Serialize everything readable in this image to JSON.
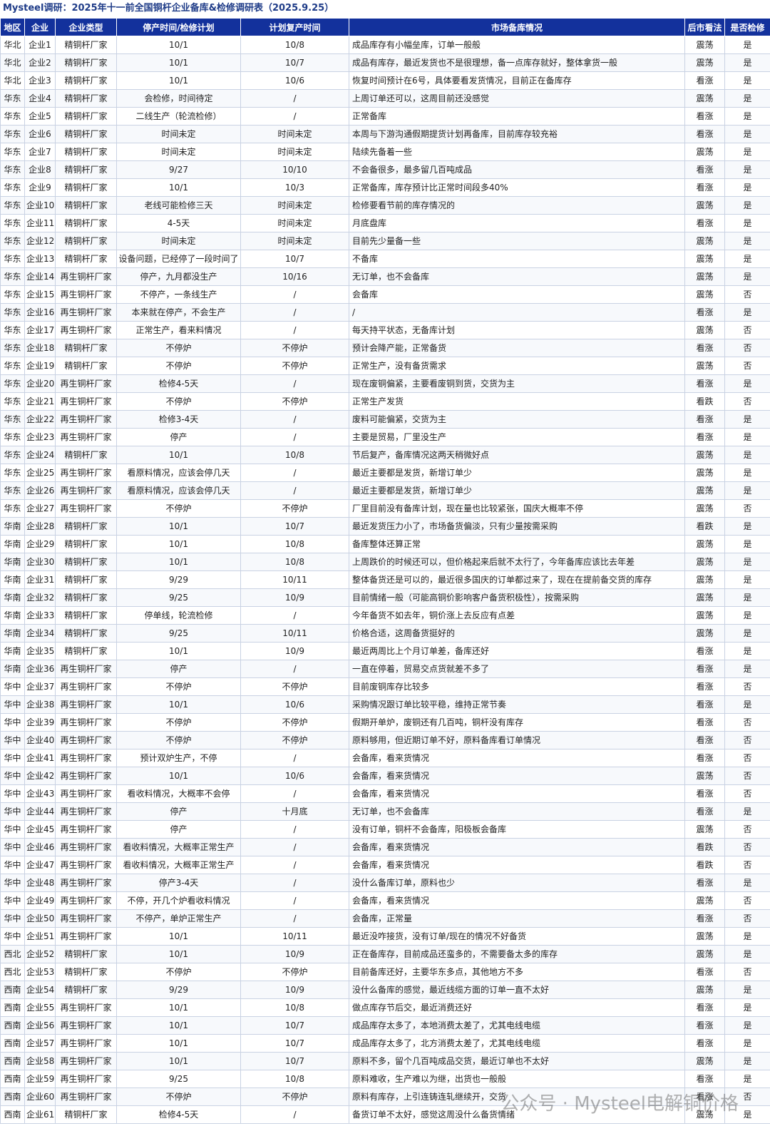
{
  "title": "Mysteel调研：2025年十一前全国铜杆企业备库&检修调研表（2025.9.25）",
  "headers": [
    "地区",
    "企业",
    "企业类型",
    "停产时间/检修计划",
    "计划复产时间",
    "市场备库情况",
    "后市看法",
    "是否检修"
  ],
  "rows": [
    [
      "华北",
      "企业1",
      "精铜杆厂家",
      "10/1",
      "10/8",
      "成品库存有小幅垒库，订单一般般",
      "震荡",
      "是"
    ],
    [
      "华北",
      "企业2",
      "精铜杆厂家",
      "10/1",
      "10/7",
      "成品有库存，最近发货也不是很理想，备一点库存就好，整体拿货一般",
      "震荡",
      "是"
    ],
    [
      "华北",
      "企业3",
      "精铜杆厂家",
      "10/1",
      "10/6",
      "恢复时间预计在6号，具体要看发货情况，目前正在备库存",
      "看涨",
      "是"
    ],
    [
      "华东",
      "企业4",
      "精铜杆厂家",
      "会检修，时间待定",
      "/",
      "上周订单还可以，这周目前还没感觉",
      "震荡",
      "是"
    ],
    [
      "华东",
      "企业5",
      "精铜杆厂家",
      "二线生产（轮流检修）",
      "/",
      "正常备库",
      "看涨",
      "是"
    ],
    [
      "华东",
      "企业6",
      "精铜杆厂家",
      "时间未定",
      "时间未定",
      "本周与下游沟通假期提货计划再备库，目前库存较充裕",
      "看涨",
      "是"
    ],
    [
      "华东",
      "企业7",
      "精铜杆厂家",
      "时间未定",
      "时间未定",
      "陆续先备着一些",
      "震荡",
      "是"
    ],
    [
      "华东",
      "企业8",
      "精铜杆厂家",
      "9/27",
      "10/10",
      "不会备很多，最多留几百吨成品",
      "看涨",
      "是"
    ],
    [
      "华东",
      "企业9",
      "精铜杆厂家",
      "10/1",
      "10/3",
      "正常备库，库存预计比正常时间段多40%",
      "看涨",
      "是"
    ],
    [
      "华东",
      "企业10",
      "精铜杆厂家",
      "老线可能检修三天",
      "时间未定",
      "检修要看节前的库存情况的",
      "震荡",
      "是"
    ],
    [
      "华东",
      "企业11",
      "精铜杆厂家",
      "4-5天",
      "时间未定",
      "月底盘库",
      "看涨",
      "是"
    ],
    [
      "华东",
      "企业12",
      "精铜杆厂家",
      "时间未定",
      "时间未定",
      "目前先少量备一些",
      "震荡",
      "是"
    ],
    [
      "华东",
      "企业13",
      "精铜杆厂家",
      "设备问题，已经停了一段时间了",
      "10/7",
      "不备库",
      "震荡",
      "是"
    ],
    [
      "华东",
      "企业14",
      "再生铜杆厂家",
      "停产，九月都没生产",
      "10/16",
      "无订单，也不会备库",
      "震荡",
      "是"
    ],
    [
      "华东",
      "企业15",
      "再生铜杆厂家",
      "不停产，一条线生产",
      "/",
      "会备库",
      "震荡",
      "否"
    ],
    [
      "华东",
      "企业16",
      "再生铜杆厂家",
      "本来就在停产，不会生产",
      "/",
      "/",
      "看涨",
      "是"
    ],
    [
      "华东",
      "企业17",
      "再生铜杆厂家",
      "正常生产，看来料情况",
      "/",
      "每天持平状态，无备库计划",
      "震荡",
      "否"
    ],
    [
      "华东",
      "企业18",
      "精铜杆厂家",
      "不停炉",
      "不停炉",
      "预计会降产能，正常备货",
      "看涨",
      "否"
    ],
    [
      "华东",
      "企业19",
      "精铜杆厂家",
      "不停炉",
      "不停炉",
      "正常生产，没有备货需求",
      "震荡",
      "否"
    ],
    [
      "华东",
      "企业20",
      "再生铜杆厂家",
      "检修4-5天",
      "/",
      "现在废铜偏紧，主要看废铜到货，交货为主",
      "看涨",
      "是"
    ],
    [
      "华东",
      "企业21",
      "再生铜杆厂家",
      "不停炉",
      "不停炉",
      "正常生产发货",
      "看跌",
      "否"
    ],
    [
      "华东",
      "企业22",
      "再生铜杆厂家",
      "检修3-4天",
      "/",
      "废料可能偏紧，交货为主",
      "看涨",
      "是"
    ],
    [
      "华东",
      "企业23",
      "再生铜杆厂家",
      "停产",
      "/",
      "主要是贸易，厂里没生产",
      "看涨",
      "是"
    ],
    [
      "华东",
      "企业24",
      "精铜杆厂家",
      "10/1",
      "10/8",
      "节后复产，备库情况这两天稍微好点",
      "震荡",
      "是"
    ],
    [
      "华东",
      "企业25",
      "再生铜杆厂家",
      "看原料情况，应该会停几天",
      "/",
      "最近主要都是发货，新增订单少",
      "震荡",
      "是"
    ],
    [
      "华东",
      "企业26",
      "再生铜杆厂家",
      "看原料情况，应该会停几天",
      "/",
      "最近主要都是发货，新增订单少",
      "震荡",
      "是"
    ],
    [
      "华东",
      "企业27",
      "再生铜杆厂家",
      "不停炉",
      "不停炉",
      "厂里目前没有备库计划，现在量也比较紧张，国庆大概率不停",
      "震荡",
      "否"
    ],
    [
      "华南",
      "企业28",
      "精铜杆厂家",
      "10/1",
      "10/7",
      "最近发货压力小了，市场备货偏淡，只有少量按需采购",
      "看跌",
      "是"
    ],
    [
      "华南",
      "企业29",
      "精铜杆厂家",
      "10/1",
      "10/8",
      "备库整体还算正常",
      "震荡",
      "是"
    ],
    [
      "华南",
      "企业30",
      "精铜杆厂家",
      "10/1",
      "10/8",
      "上周跌价的时候还可以，但价格起来后就不太行了，今年备库应该比去年差",
      "震荡",
      "是"
    ],
    [
      "华南",
      "企业31",
      "精铜杆厂家",
      "9/29",
      "10/11",
      "整体备货还是可以的，最近很多国庆的订单都过来了，现在在提前备交货的库存",
      "震荡",
      "是"
    ],
    [
      "华南",
      "企业32",
      "精铜杆厂家",
      "9/25",
      "10/9",
      "目前情绪一般（可能高铜价影响客户备货积极性），按需采购",
      "震荡",
      "是"
    ],
    [
      "华南",
      "企业33",
      "精铜杆厂家",
      "停单线，轮流检修",
      "/",
      "今年备货不如去年，铜价涨上去反应有点差",
      "震荡",
      "是"
    ],
    [
      "华南",
      "企业34",
      "精铜杆厂家",
      "9/25",
      "10/11",
      "价格合适，这周备货挺好的",
      "震荡",
      "是"
    ],
    [
      "华南",
      "企业35",
      "精铜杆厂家",
      "10/1",
      "10/9",
      "最近两周比上个月订单差，备库还好",
      "看涨",
      "是"
    ],
    [
      "华南",
      "企业36",
      "再生铜杆厂家",
      "停产",
      "/",
      "一直在停着，贸易交点货就差不多了",
      "看涨",
      "是"
    ],
    [
      "华中",
      "企业37",
      "再生铜杆厂家",
      "不停炉",
      "不停炉",
      "目前废铜库存比较多",
      "看涨",
      "否"
    ],
    [
      "华中",
      "企业38",
      "再生铜杆厂家",
      "10/1",
      "10/6",
      "采购情况跟订单比较平稳，维持正常节奏",
      "看涨",
      "是"
    ],
    [
      "华中",
      "企业39",
      "再生铜杆厂家",
      "不停炉",
      "不停炉",
      "假期开单炉，废铜还有几百吨，铜杆没有库存",
      "看涨",
      "否"
    ],
    [
      "华中",
      "企业40",
      "再生铜杆厂家",
      "不停炉",
      "不停炉",
      "原料够用，但近期订单不好，原料备库看订单情况",
      "看涨",
      "否"
    ],
    [
      "华中",
      "企业41",
      "再生铜杆厂家",
      "预计双炉生产，不停",
      "/",
      "会备库，看来货情况",
      "看涨",
      "否"
    ],
    [
      "华中",
      "企业42",
      "再生铜杆厂家",
      "10/1",
      "10/6",
      "会备库，看来货情况",
      "震荡",
      "否"
    ],
    [
      "华中",
      "企业43",
      "再生铜杆厂家",
      "看收料情况，大概率不会停",
      "/",
      "会备库，看来货情况",
      "看涨",
      "否"
    ],
    [
      "华中",
      "企业44",
      "再生铜杆厂家",
      "停产",
      "十月底",
      "无订单，也不会备库",
      "看涨",
      "是"
    ],
    [
      "华中",
      "企业45",
      "再生铜杆厂家",
      "停产",
      "/",
      "没有订单，铜杆不会备库，阳极板会备库",
      "震荡",
      "否"
    ],
    [
      "华中",
      "企业46",
      "再生铜杆厂家",
      "看收料情况，大概率正常生产",
      "/",
      "会备库，看来货情况",
      "看跌",
      "否"
    ],
    [
      "华中",
      "企业47",
      "再生铜杆厂家",
      "看收料情况，大概率正常生产",
      "/",
      "会备库，看来货情况",
      "看跌",
      "否"
    ],
    [
      "华中",
      "企业48",
      "再生铜杆厂家",
      "停产3-4天",
      "/",
      "没什么备库订单，原料也少",
      "看涨",
      "是"
    ],
    [
      "华中",
      "企业49",
      "再生铜杆厂家",
      "不停，开几个炉看收料情况",
      "/",
      "会备库，看来货情况",
      "震荡",
      "否"
    ],
    [
      "华中",
      "企业50",
      "再生铜杆厂家",
      "不停产，单炉正常生产",
      "/",
      "会备库，正常量",
      "看涨",
      "否"
    ],
    [
      "华中",
      "企业51",
      "再生铜杆厂家",
      "10/1",
      "10/11",
      "最近没咋接货，没有订单/现在的情况不好备货",
      "震荡",
      "是"
    ],
    [
      "西北",
      "企业52",
      "精铜杆厂家",
      "10/1",
      "10/9",
      "正在备库存，目前成品还蛮多的，不需要备太多的库存",
      "震荡",
      "是"
    ],
    [
      "西北",
      "企业53",
      "精铜杆厂家",
      "不停炉",
      "不停炉",
      "目前备库还好，主要华东多点，其他地方不多",
      "看涨",
      "否"
    ],
    [
      "西南",
      "企业54",
      "精铜杆厂家",
      "9/29",
      "10/9",
      "没什么备库的感觉，最近线缆方面的订单一直不太好",
      "震荡",
      "是"
    ],
    [
      "西南",
      "企业55",
      "再生铜杆厂家",
      "10/1",
      "10/8",
      "做点库存节后交，最近消费还好",
      "看涨",
      "是"
    ],
    [
      "西南",
      "企业56",
      "再生铜杆厂家",
      "10/1",
      "10/7",
      "成品库存太多了，本地消费太差了，尤其电线电缆",
      "看涨",
      "是"
    ],
    [
      "西南",
      "企业57",
      "再生铜杆厂家",
      "10/1",
      "10/7",
      "成品库存太多了，北方消费太差了，尤其电线电缆",
      "看涨",
      "是"
    ],
    [
      "西南",
      "企业58",
      "再生铜杆厂家",
      "10/1",
      "10/7",
      "原料不多，留个几百吨成品交货，最近订单也不太好",
      "震荡",
      "是"
    ],
    [
      "西南",
      "企业59",
      "再生铜杆厂家",
      "9/25",
      "10/8",
      "原料难收，生产难以为继，出货也一般般",
      "看涨",
      "是"
    ],
    [
      "西南",
      "企业60",
      "再生铜杆厂家",
      "不停炉",
      "不停炉",
      "原料有库存，上引连铸连轧继续开，交货",
      "看涨",
      "否"
    ],
    [
      "西南",
      "企业61",
      "精铜杆厂家",
      "检修4-5天",
      "/",
      "备货订单不太好，感觉这周没什么备货情绪",
      "震荡",
      "是"
    ]
  ],
  "watermark": "公众号 · Mysteel电解铜价格"
}
